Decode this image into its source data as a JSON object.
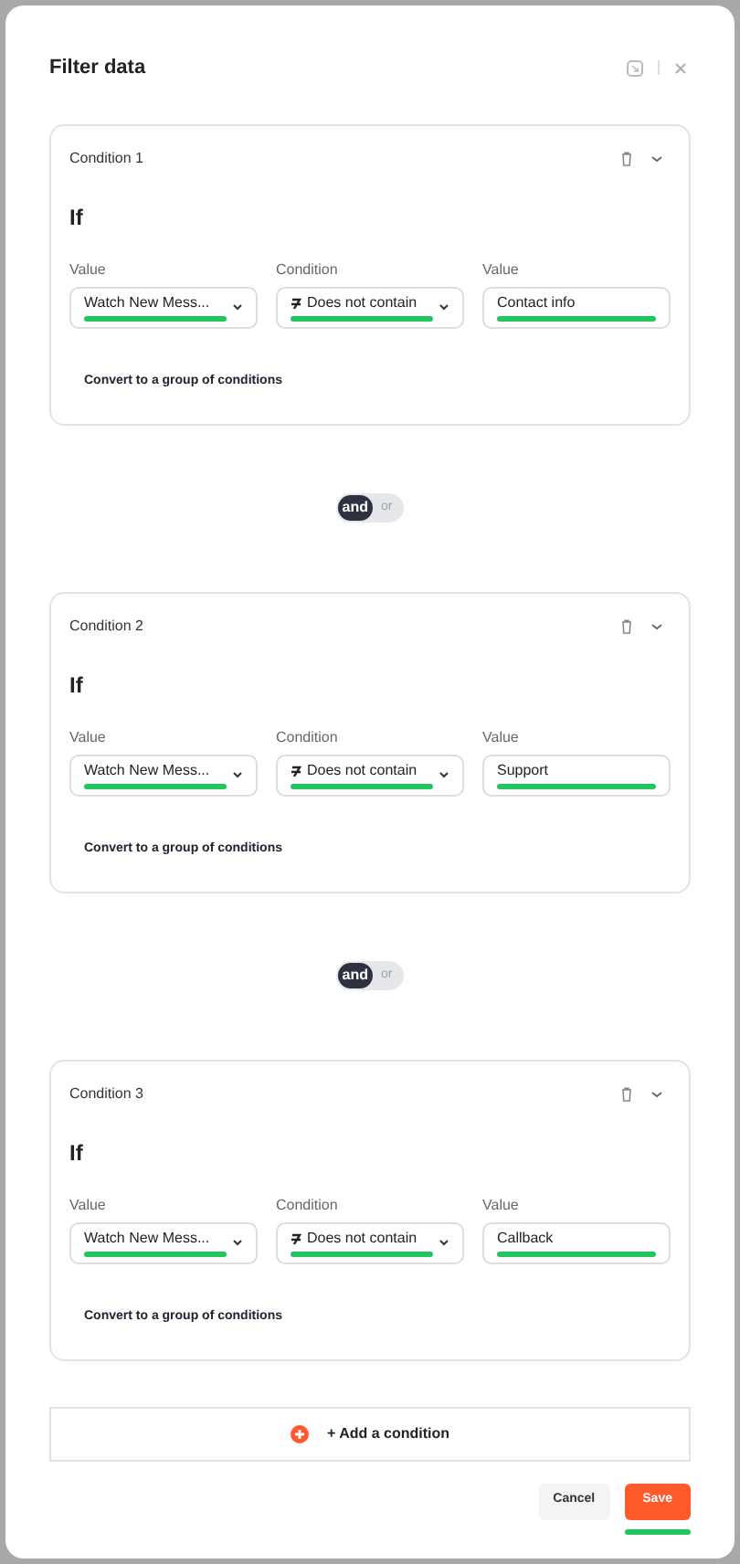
{
  "dialog": {
    "title": "Filter data"
  },
  "conditions": [
    {
      "title": "Condition 1",
      "heading": "If",
      "fields": [
        {
          "kind": "select",
          "label": "Value",
          "value": "Watch New Mess...",
          "underlined": true
        },
        {
          "kind": "operator",
          "label": "Condition",
          "value": "Does not contain",
          "underlined": true
        },
        {
          "kind": "text",
          "label": "Value",
          "value": "Contact info",
          "underlined": true
        }
      ],
      "convert_link": "Convert to a group of conditions"
    },
    {
      "title": "Condition 2",
      "heading": "If",
      "fields": [
        {
          "kind": "select",
          "label": "Value",
          "value": "Watch New Mess...",
          "underlined": true
        },
        {
          "kind": "operator",
          "label": "Condition",
          "value": "Does not contain",
          "underlined": true
        },
        {
          "kind": "text",
          "label": "Value",
          "value": "Support",
          "underlined": true
        }
      ],
      "convert_link": "Convert to a group of conditions"
    },
    {
      "title": "Condition 3",
      "heading": "If",
      "fields": [
        {
          "kind": "select",
          "label": "Value",
          "value": "Watch New Mess...",
          "underlined": true
        },
        {
          "kind": "operator",
          "label": "Condition",
          "value": "Does not contain",
          "underlined": true
        },
        {
          "kind": "text",
          "label": "Value",
          "value": "Callback",
          "underlined": true
        }
      ],
      "convert_link": "Convert to a group of conditions"
    }
  ],
  "connectors": [
    {
      "options": [
        {
          "label": "and",
          "selected": true
        },
        {
          "label": "or",
          "selected": false
        }
      ]
    },
    {
      "options": [
        {
          "label": "and",
          "selected": true
        },
        {
          "label": "or",
          "selected": false
        }
      ]
    }
  ],
  "add_condition": "+ Add a condition",
  "buttons": [
    {
      "kind": "secondary",
      "label": "Cancel",
      "underlined": false
    },
    {
      "kind": "primary",
      "label": "Save",
      "underlined": true
    }
  ]
}
